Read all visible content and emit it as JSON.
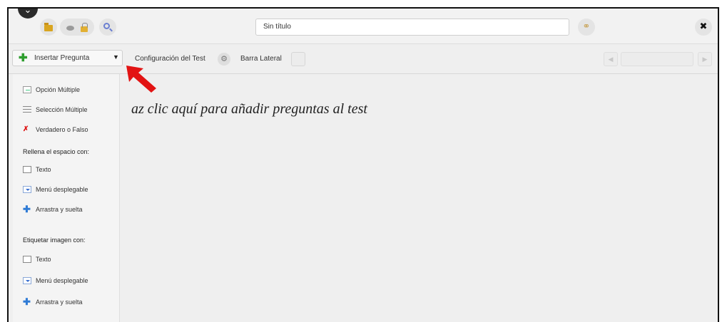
{
  "header": {
    "title_value": "Sin título",
    "icons": [
      "folder-icon",
      "disk-icon",
      "lock-icon",
      "magnifier-icon",
      "share-icon",
      "close-icon"
    ]
  },
  "toolbar": {
    "insert_label": "Insertar Pregunta",
    "config_label": "Configuración del Test",
    "sidebar_label": "Barra Lateral"
  },
  "menu": {
    "items": [
      {
        "label": "Opción Múltiple"
      },
      {
        "label": "Selección Múltiple"
      },
      {
        "label": "Verdadero o Falso"
      }
    ],
    "section_blank": "Rellena el espacio con:",
    "blank_items": [
      {
        "label": "Texto"
      },
      {
        "label": "Menú desplegable"
      },
      {
        "label": "Arrastra y suelta"
      }
    ],
    "section_image": "Etiquetar imagen con:",
    "image_items": [
      {
        "label": "Texto"
      },
      {
        "label": "Menú desplegable"
      },
      {
        "label": "Arrastra y suelta"
      }
    ]
  },
  "canvas": {
    "hint": "az clic aquí para añadir preguntas al test"
  },
  "colors": {
    "accent_green": "#2e9e2e",
    "arrow_red": "#e21313"
  }
}
